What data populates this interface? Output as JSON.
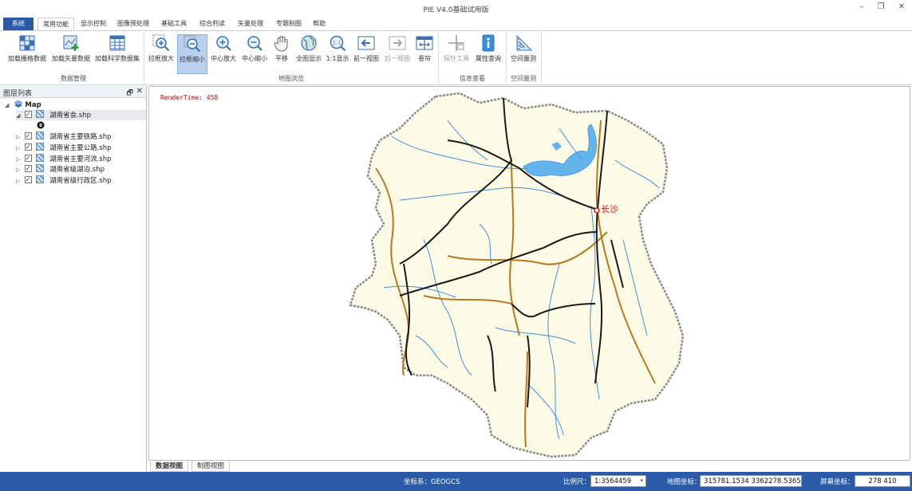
{
  "window": {
    "title": "PIE V4.0基础试用版",
    "minimize": "–",
    "restore": "❐",
    "close": "✕"
  },
  "tabs": [
    "系统",
    "常用功能",
    "显示控制",
    "图像预处理",
    "基础工具",
    "综合判读",
    "矢量处理",
    "专题制图",
    "帮助"
  ],
  "ribbon": {
    "buttons": [
      {
        "label": "加载栅格数据",
        "icon": "raster-grid-icon"
      },
      {
        "label": "加载矢量数据",
        "icon": "vector-add-icon"
      },
      {
        "label": "加载科学数据集",
        "icon": "table-grid-icon"
      },
      {
        "label": "拉框放大",
        "icon": "box-zoom-in-icon"
      },
      {
        "label": "拉框缩小",
        "icon": "box-zoom-out-icon"
      },
      {
        "label": "中心放大",
        "icon": "zoom-in-icon"
      },
      {
        "label": "中心缩小",
        "icon": "zoom-out-icon"
      },
      {
        "label": "平移",
        "icon": "hand-pan-icon"
      },
      {
        "label": "全图显示",
        "icon": "globe-icon"
      },
      {
        "label": "1:1显示",
        "icon": "one-to-one-icon"
      },
      {
        "label": "前一视图",
        "icon": "arrow-left-icon"
      },
      {
        "label": "后一视图",
        "icon": "arrow-right-icon"
      },
      {
        "label": "卷帘",
        "icon": "swipe-icon"
      },
      {
        "label": "探针工具",
        "icon": "probe-crosshair-icon"
      },
      {
        "label": "属性查询",
        "icon": "info-query-icon"
      },
      {
        "label": "空间量测",
        "icon": "ruler-measure-icon"
      }
    ],
    "groups": [
      "数据管理",
      "地图浏览",
      "信息查看",
      "空间量测"
    ]
  },
  "layer_panel": {
    "title": "图层列表",
    "pin": "🗗",
    "close": "✕",
    "root": "Map",
    "layers": [
      "湖南省会.shp",
      "湖南省主要铁路.shp",
      "湖南省主要公路.shp",
      "湖南省主要河流.shp",
      "湖南省级湖泊.shp",
      "湖南省级行政区.shp"
    ]
  },
  "map": {
    "render_time": "RenderTime: 458",
    "city_label": "长沙",
    "colors": {
      "land": "#fdfbe6",
      "boundary": "#8a8a8a",
      "rivers": "#3f8fe0",
      "lakes": "#62b4ea",
      "railway": "#1a1a1a",
      "highway": "#b97a1e",
      "capital": "#e01010"
    }
  },
  "view_tabs": [
    "数据视图",
    "制图视图"
  ],
  "status": {
    "crs_label": "坐标系：GEOGCS",
    "scale_label": "比例尺：",
    "scale_value": "1:3564459",
    "map_coord_label": "地图坐标：",
    "map_coord_value": "315781.1534  3362278.5365",
    "screen_coord_label": "屏幕坐标：",
    "screen_coord_value": "278  410"
  }
}
